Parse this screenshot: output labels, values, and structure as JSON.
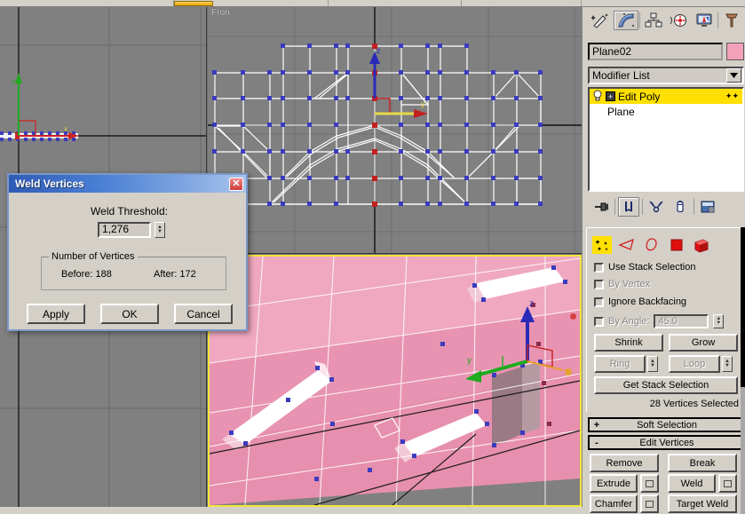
{
  "toolbar": {
    "accent_color": "#e8a317"
  },
  "viewports": {
    "top": {
      "label": ""
    },
    "front": {
      "label": "Fron"
    },
    "perspective": {
      "label": "",
      "active_border_color": "#f2e53c",
      "mesh_color": "#f0a8c0"
    }
  },
  "command_panel": {
    "tabs": [
      {
        "name": "create-tab",
        "icon": "wand-icon",
        "label": "Create",
        "active": false
      },
      {
        "name": "modify-tab",
        "icon": "curve-icon",
        "label": "Modify",
        "active": true
      },
      {
        "name": "hierarchy-tab",
        "icon": "hierarchy-icon",
        "label": "Hierarchy",
        "active": false
      },
      {
        "name": "motion-tab",
        "icon": "wheel-icon",
        "label": "Motion",
        "active": false
      },
      {
        "name": "display-tab",
        "icon": "monitor-icon",
        "label": "Display",
        "active": false
      },
      {
        "name": "utilities-tab",
        "icon": "hammer-icon",
        "label": "Utilities",
        "active": false
      }
    ],
    "object_name": "Plane02",
    "object_color": "#f4a0b8",
    "modifier_list_label": "Modifier List",
    "stack": [
      {
        "label": "Edit Poly",
        "selected": true
      },
      {
        "label": "Plane",
        "selected": false
      }
    ],
    "stack_tools": [
      {
        "name": "pin-stack-button",
        "icon": "pin-icon",
        "pressed": false
      },
      {
        "name": "show-end-result-button",
        "icon": "show-end-result-icon",
        "pressed": true
      },
      {
        "name": "make-unique-button",
        "icon": "make-unique-icon",
        "pressed": false
      },
      {
        "name": "remove-modifier-button",
        "icon": "trash-icon",
        "pressed": false
      },
      {
        "name": "configure-sets-button",
        "icon": "configure-sets-icon",
        "pressed": false
      }
    ],
    "selection": {
      "subobject_icons": [
        {
          "name": "vertex-subobject",
          "label": "Vertex",
          "active": true
        },
        {
          "name": "edge-subobject",
          "label": "Edge",
          "active": false
        },
        {
          "name": "border-subobject",
          "label": "Border",
          "active": false
        },
        {
          "name": "polygon-subobject",
          "label": "Polygon",
          "active": false
        },
        {
          "name": "element-subobject",
          "label": "Element",
          "active": false
        }
      ],
      "use_stack_selection": "Use Stack Selection",
      "by_vertex": "By Vertex",
      "ignore_backfacing": "Ignore Backfacing",
      "by_angle": "By Angle:",
      "by_angle_value": "45.0",
      "shrink": "Shrink",
      "grow": "Grow",
      "ring": "Ring",
      "loop": "Loop",
      "get_stack_selection": "Get Stack Selection",
      "selection_count": "28 Vertices Selected"
    },
    "rollouts": [
      {
        "name": "soft-selection-rollout",
        "sign": "+",
        "title": "Soft Selection"
      },
      {
        "name": "edit-vertices-rollout",
        "sign": "-",
        "title": "Edit Vertices"
      }
    ],
    "edit_vertices": {
      "remove": "Remove",
      "break": "Break",
      "extrude": "Extrude",
      "weld": "Weld",
      "chamfer": "Chamfer",
      "target_weld": "Target Weld"
    }
  },
  "weld_dialog": {
    "title": "Weld Vertices",
    "close_label": "✕",
    "threshold_label": "Weld Threshold:",
    "threshold_value": "1,276",
    "group_title": "Number of Vertices",
    "before_label": "Before: 188",
    "after_label": "After:  172",
    "apply": "Apply",
    "ok": "OK",
    "cancel": "Cancel"
  }
}
